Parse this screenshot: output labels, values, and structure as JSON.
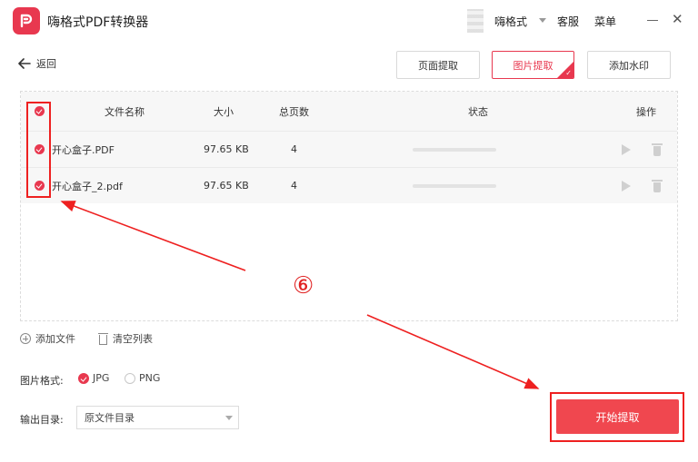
{
  "app": {
    "title": "嗨格式PDF转换器"
  },
  "titlebar": {
    "user": "嗨格式",
    "service": "客服",
    "menu": "菜单"
  },
  "nav": {
    "back": "返回"
  },
  "tabs": [
    {
      "label": "页面提取",
      "active": false
    },
    {
      "label": "图片提取",
      "active": true
    },
    {
      "label": "添加水印",
      "active": false
    }
  ],
  "table": {
    "headers": {
      "name": "文件名称",
      "size": "大小",
      "pages": "总页数",
      "status": "状态",
      "actions": "操作"
    },
    "rows": [
      {
        "name": "开心盒子.PDF",
        "size": "97.65 KB",
        "pages": "4",
        "progress": 0
      },
      {
        "name": "开心盒子_2.pdf",
        "size": "97.65 KB",
        "pages": "4",
        "progress": 0
      }
    ]
  },
  "annotation": {
    "step": "⑥"
  },
  "actions": {
    "add_file": "添加文件",
    "clear_list": "清空列表"
  },
  "format": {
    "label": "图片格式:",
    "options": [
      {
        "label": "JPG",
        "selected": true
      },
      {
        "label": "PNG",
        "selected": false
      }
    ]
  },
  "output": {
    "label": "输出目录:",
    "value": "原文件目录"
  },
  "start": {
    "label": "开始提取"
  },
  "colors": {
    "accent": "#e8384f",
    "annotation": "#ee2020"
  }
}
